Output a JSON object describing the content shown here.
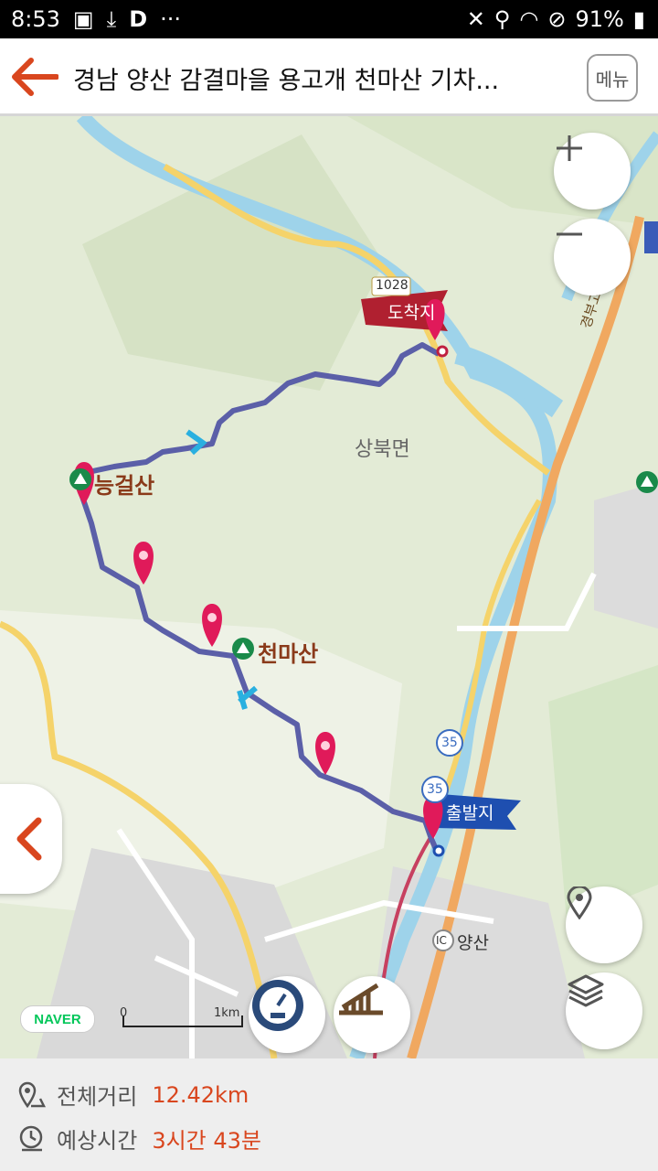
{
  "status_bar": {
    "time": "8:53",
    "dots": "···",
    "d_icon": "D",
    "battery": "91%"
  },
  "header": {
    "title": "경남 양산 감결마을 용고개 천마산 기차...",
    "menu_label": "메뉴"
  },
  "map": {
    "labels": {
      "arrival": "도착지",
      "departure": "출발지",
      "peak1": "능걸산",
      "peak2": "천마산",
      "town": "상북면",
      "ic": "양산",
      "ic_badge": "IC",
      "road1028": "1028",
      "road35": "35",
      "road35b": "35",
      "expressway": "경부고속"
    },
    "scale": {
      "zero": "0",
      "one": "1km"
    },
    "naver": "NAVER"
  },
  "summary": {
    "distance_label": "전체거리",
    "distance_value": "12.42km",
    "time_label": "예상시간",
    "time_value": "3시간 43분"
  },
  "colors": {
    "route": "#5b5fa8",
    "accent": "#d9461e",
    "pin": "#e01a5a",
    "arrival_flag": "#b02030",
    "departure_flag": "#1e4fb0"
  }
}
